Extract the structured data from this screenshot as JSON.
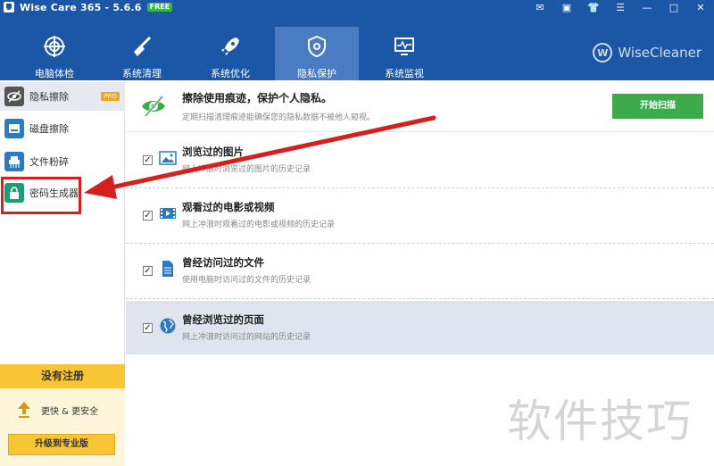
{
  "window": {
    "title": "Wise Care 365 - 5.6.6",
    "badge": "FREE",
    "controls": {
      "mail": "✉",
      "feedback": "▣",
      "skin": "👕",
      "menu": "☰",
      "minimize": "—",
      "maximize": "□",
      "close": "✕"
    }
  },
  "topnav": {
    "tabs": [
      {
        "label": "电脑体检",
        "icon": "target-icon"
      },
      {
        "label": "系统清理",
        "icon": "broom-icon"
      },
      {
        "label": "系统优化",
        "icon": "rocket-icon"
      },
      {
        "label": "隐私保护",
        "icon": "shield-icon",
        "active": true
      },
      {
        "label": "系统监视",
        "icon": "monitor-icon"
      }
    ],
    "brand": "WiseCleaner",
    "brand_logo": "W"
  },
  "sidebar": {
    "items": [
      {
        "label": "隐私擦除",
        "badge": "PRO",
        "icon": "eye-slash-icon",
        "active": true
      },
      {
        "label": "磁盘擦除",
        "icon": "disk-icon"
      },
      {
        "label": "文件粉碎",
        "icon": "shredder-icon"
      },
      {
        "label": "密码生成器",
        "icon": "lock-icon"
      }
    ],
    "register": {
      "title": "没有注册",
      "tagline": "更快 & 更安全",
      "upgrade_label": "升级到专业版"
    }
  },
  "main": {
    "header": {
      "title": "擦除使用痕迹，保护个人隐私。",
      "subtitle": "定期扫描清理痕迹能确保您的隐私数据不被他人窥视。",
      "scan_label": "开始扫描"
    },
    "items": [
      {
        "title": "浏览过的图片",
        "subtitle": "网上冲浪时浏览过的图片的历史记录",
        "checked": true,
        "icon": "image-icon"
      },
      {
        "title": "观看过的电影或视频",
        "subtitle": "网上冲浪时观看过的电影或视频的历史记录",
        "checked": true,
        "icon": "film-icon"
      },
      {
        "title": "曾经访问过的文件",
        "subtitle": "使用电脑时访问过的文件的历史记录",
        "checked": true,
        "icon": "document-icon"
      },
      {
        "title": "曾经浏览过的页面",
        "subtitle": "网上冲浪时访问过的网站的历史记录",
        "checked": true,
        "icon": "globe-icon",
        "selected": true
      }
    ],
    "check_glyph": "✓"
  },
  "watermark": "软件技巧",
  "colors": {
    "titlebar": "#1c56a6",
    "active_tab": "#4a7cc4",
    "scan_button": "#3dab49",
    "register_yellow": "#f7c535",
    "annotation_red": "#d62020"
  }
}
